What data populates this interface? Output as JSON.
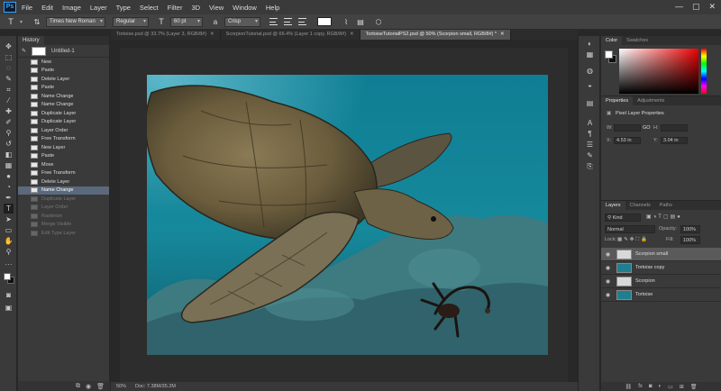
{
  "app": {
    "logo": "Ps"
  },
  "menu": [
    "File",
    "Edit",
    "Image",
    "Layer",
    "Type",
    "Select",
    "Filter",
    "3D",
    "View",
    "Window",
    "Help"
  ],
  "window_controls": [
    "—",
    "▢",
    "✕"
  ],
  "options_bar": {
    "tool_glyph": "T",
    "font_family": "Times New Roman",
    "font_style": "Regular",
    "size_glyph": "T",
    "font_size": "60 pt",
    "aa_glyph": "a",
    "aa_mode": "Crisp",
    "text_color": "#ffffff"
  },
  "history": {
    "tab_label": "History",
    "snapshot_label": "Untitled-1",
    "items": [
      {
        "label": "New",
        "state": "normal"
      },
      {
        "label": "Paste",
        "state": "normal"
      },
      {
        "label": "Delete Layer",
        "state": "normal"
      },
      {
        "label": "Paste",
        "state": "normal"
      },
      {
        "label": "Name Change",
        "state": "normal"
      },
      {
        "label": "Name Change",
        "state": "normal"
      },
      {
        "label": "Duplicate Layer",
        "state": "normal"
      },
      {
        "label": "Duplicate Layer",
        "state": "normal"
      },
      {
        "label": "Layer Order",
        "state": "normal"
      },
      {
        "label": "Free Transform",
        "state": "normal"
      },
      {
        "label": "New Layer",
        "state": "normal"
      },
      {
        "label": "Paste",
        "state": "normal"
      },
      {
        "label": "Move",
        "state": "normal"
      },
      {
        "label": "Free Transform",
        "state": "normal"
      },
      {
        "label": "Delete Layer",
        "state": "normal"
      },
      {
        "label": "Name Change",
        "state": "selected"
      },
      {
        "label": "Duplicate Layer",
        "state": "undone"
      },
      {
        "label": "Layer Order",
        "state": "undone"
      },
      {
        "label": "Rasterize",
        "state": "undone"
      },
      {
        "label": "Merge Visible",
        "state": "undone"
      },
      {
        "label": "Edit Type Layer",
        "state": "undone"
      }
    ]
  },
  "document_tabs": [
    {
      "label": "Tortoise.psd @ 33.7% (Layer 3, RGB/8#)",
      "active": false
    },
    {
      "label": "ScorpionTutorial.psd @ 66.4% (Layer 1 copy, RGB/8#)",
      "active": false
    },
    {
      "label": "TortoiseTutorialPS2.psd @ 50% (Scorpion small, RGB/8#) *",
      "active": true
    }
  ],
  "status_bar": {
    "zoom": "50%",
    "doc_size": "Doc: 7.38M/35.2M"
  },
  "color_panel": {
    "tabs": [
      "Color",
      "Swatches"
    ],
    "foreground": "#ffffff",
    "background": "#111111"
  },
  "properties_panel": {
    "tabs": [
      "Properties",
      "Adjustments"
    ],
    "title": "Pixel Layer Properties",
    "w_label": "W:",
    "h_label": "H:",
    "x_label": "X:",
    "y_label": "Y:",
    "link_glyph": "GO",
    "x_value": "4.53 in",
    "y_value": "3.04 in"
  },
  "layers_panel": {
    "tabs": [
      "Layers",
      "Channels",
      "Paths"
    ],
    "filter": "Kind",
    "blend_mode": "Normal",
    "opacity_label": "Opacity:",
    "opacity_value": "100%",
    "lock_label": "Lock:",
    "fill_label": "Fill:",
    "fill_value": "100%",
    "layers": [
      {
        "name": "Scorpion small",
        "selected": true,
        "thumb": "#d8d8d8"
      },
      {
        "name": "Tortoise copy",
        "selected": false,
        "thumb": "#1f7f8f"
      },
      {
        "name": "Scorpion",
        "selected": false,
        "thumb": "#d8d8d8"
      },
      {
        "name": "Tortoise",
        "selected": false,
        "thumb": "#1f7f8f"
      }
    ]
  }
}
